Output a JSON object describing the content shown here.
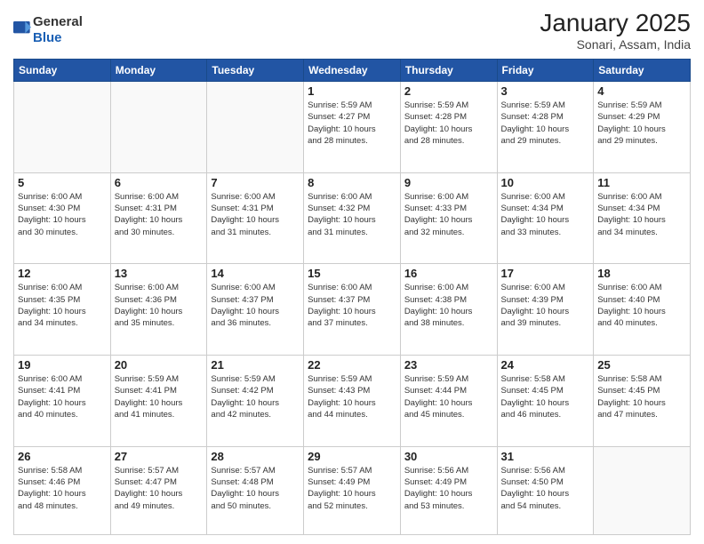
{
  "header": {
    "logo": {
      "general": "General",
      "blue": "Blue"
    },
    "title": "January 2025",
    "location": "Sonari, Assam, India"
  },
  "weekdays": [
    "Sunday",
    "Monday",
    "Tuesday",
    "Wednesday",
    "Thursday",
    "Friday",
    "Saturday"
  ],
  "weeks": [
    [
      {
        "day": null,
        "info": null
      },
      {
        "day": null,
        "info": null
      },
      {
        "day": null,
        "info": null
      },
      {
        "day": "1",
        "info": "Sunrise: 5:59 AM\nSunset: 4:27 PM\nDaylight: 10 hours\nand 28 minutes."
      },
      {
        "day": "2",
        "info": "Sunrise: 5:59 AM\nSunset: 4:28 PM\nDaylight: 10 hours\nand 28 minutes."
      },
      {
        "day": "3",
        "info": "Sunrise: 5:59 AM\nSunset: 4:28 PM\nDaylight: 10 hours\nand 29 minutes."
      },
      {
        "day": "4",
        "info": "Sunrise: 5:59 AM\nSunset: 4:29 PM\nDaylight: 10 hours\nand 29 minutes."
      }
    ],
    [
      {
        "day": "5",
        "info": "Sunrise: 6:00 AM\nSunset: 4:30 PM\nDaylight: 10 hours\nand 30 minutes."
      },
      {
        "day": "6",
        "info": "Sunrise: 6:00 AM\nSunset: 4:31 PM\nDaylight: 10 hours\nand 30 minutes."
      },
      {
        "day": "7",
        "info": "Sunrise: 6:00 AM\nSunset: 4:31 PM\nDaylight: 10 hours\nand 31 minutes."
      },
      {
        "day": "8",
        "info": "Sunrise: 6:00 AM\nSunset: 4:32 PM\nDaylight: 10 hours\nand 31 minutes."
      },
      {
        "day": "9",
        "info": "Sunrise: 6:00 AM\nSunset: 4:33 PM\nDaylight: 10 hours\nand 32 minutes."
      },
      {
        "day": "10",
        "info": "Sunrise: 6:00 AM\nSunset: 4:34 PM\nDaylight: 10 hours\nand 33 minutes."
      },
      {
        "day": "11",
        "info": "Sunrise: 6:00 AM\nSunset: 4:34 PM\nDaylight: 10 hours\nand 34 minutes."
      }
    ],
    [
      {
        "day": "12",
        "info": "Sunrise: 6:00 AM\nSunset: 4:35 PM\nDaylight: 10 hours\nand 34 minutes."
      },
      {
        "day": "13",
        "info": "Sunrise: 6:00 AM\nSunset: 4:36 PM\nDaylight: 10 hours\nand 35 minutes."
      },
      {
        "day": "14",
        "info": "Sunrise: 6:00 AM\nSunset: 4:37 PM\nDaylight: 10 hours\nand 36 minutes."
      },
      {
        "day": "15",
        "info": "Sunrise: 6:00 AM\nSunset: 4:37 PM\nDaylight: 10 hours\nand 37 minutes."
      },
      {
        "day": "16",
        "info": "Sunrise: 6:00 AM\nSunset: 4:38 PM\nDaylight: 10 hours\nand 38 minutes."
      },
      {
        "day": "17",
        "info": "Sunrise: 6:00 AM\nSunset: 4:39 PM\nDaylight: 10 hours\nand 39 minutes."
      },
      {
        "day": "18",
        "info": "Sunrise: 6:00 AM\nSunset: 4:40 PM\nDaylight: 10 hours\nand 40 minutes."
      }
    ],
    [
      {
        "day": "19",
        "info": "Sunrise: 6:00 AM\nSunset: 4:41 PM\nDaylight: 10 hours\nand 40 minutes."
      },
      {
        "day": "20",
        "info": "Sunrise: 5:59 AM\nSunset: 4:41 PM\nDaylight: 10 hours\nand 41 minutes."
      },
      {
        "day": "21",
        "info": "Sunrise: 5:59 AM\nSunset: 4:42 PM\nDaylight: 10 hours\nand 42 minutes."
      },
      {
        "day": "22",
        "info": "Sunrise: 5:59 AM\nSunset: 4:43 PM\nDaylight: 10 hours\nand 44 minutes."
      },
      {
        "day": "23",
        "info": "Sunrise: 5:59 AM\nSunset: 4:44 PM\nDaylight: 10 hours\nand 45 minutes."
      },
      {
        "day": "24",
        "info": "Sunrise: 5:58 AM\nSunset: 4:45 PM\nDaylight: 10 hours\nand 46 minutes."
      },
      {
        "day": "25",
        "info": "Sunrise: 5:58 AM\nSunset: 4:45 PM\nDaylight: 10 hours\nand 47 minutes."
      }
    ],
    [
      {
        "day": "26",
        "info": "Sunrise: 5:58 AM\nSunset: 4:46 PM\nDaylight: 10 hours\nand 48 minutes."
      },
      {
        "day": "27",
        "info": "Sunrise: 5:57 AM\nSunset: 4:47 PM\nDaylight: 10 hours\nand 49 minutes."
      },
      {
        "day": "28",
        "info": "Sunrise: 5:57 AM\nSunset: 4:48 PM\nDaylight: 10 hours\nand 50 minutes."
      },
      {
        "day": "29",
        "info": "Sunrise: 5:57 AM\nSunset: 4:49 PM\nDaylight: 10 hours\nand 52 minutes."
      },
      {
        "day": "30",
        "info": "Sunrise: 5:56 AM\nSunset: 4:49 PM\nDaylight: 10 hours\nand 53 minutes."
      },
      {
        "day": "31",
        "info": "Sunrise: 5:56 AM\nSunset: 4:50 PM\nDaylight: 10 hours\nand 54 minutes."
      },
      {
        "day": null,
        "info": null
      }
    ]
  ]
}
